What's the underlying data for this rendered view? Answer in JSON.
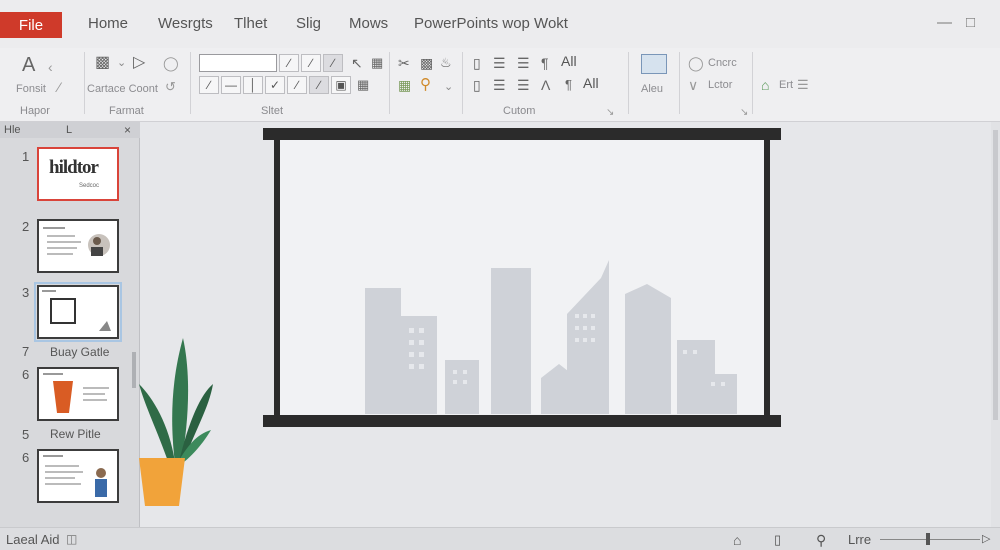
{
  "menubar": {
    "file_label": "File",
    "items": [
      "Home",
      "Wesrgts",
      "Tlhet",
      "Slig",
      "Mows",
      "PowerPoints wop Wokt"
    ]
  },
  "ribbon": {
    "groups": {
      "paste": "Hapor",
      "format": "Farmat",
      "draw": "Sltet",
      "custom": "Cutom"
    },
    "paste_sub": "Fonsit",
    "format_sub": "Cartace Coont",
    "font_all_1": "All",
    "font_all_2": "All",
    "alt_label": "Aleu",
    "right_top": "Cncrc",
    "right_mid": "Lctor",
    "right_side": "Ert"
  },
  "thumbs": {
    "header_left": "Hle",
    "header_mid": "L",
    "numbers": [
      "1",
      "2",
      "3",
      "7",
      "6",
      "5",
      "6"
    ],
    "slide1_title": "hildtor",
    "slide1_sub": "Sedcoc",
    "caption_a": "Buay Gatle",
    "caption_b": "Rew Pitle"
  },
  "statusbar": {
    "left": "Laeal Aid",
    "right": "Lrre"
  },
  "colors": {
    "file_tab": "#cf3a2a",
    "selected_thumb": "#d9443a",
    "plant_pot": "#f1a33a",
    "plant_leaf": "#2f6b47",
    "skyline": "#cfd2d8"
  },
  "icons": [
    "text-icon",
    "paste-icon",
    "shape-icon",
    "pen-icon",
    "align-icon",
    "search-icon",
    "screen-icon",
    "clock-icon",
    "home-icon",
    "zoom-icon"
  ]
}
